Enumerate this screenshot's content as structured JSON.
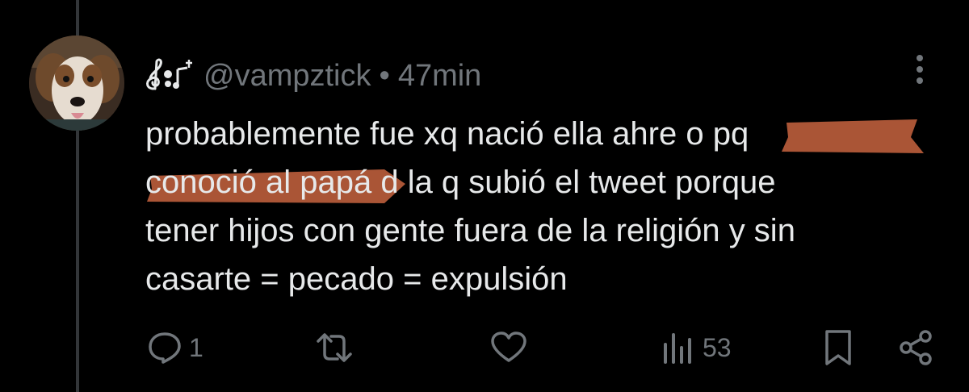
{
  "tweet": {
    "handle": "@vampztick",
    "separator": "•",
    "timestamp": "47min",
    "text_lines": [
      "probablemente fue xq nació ella ahre o pq",
      "conoció al papá d la q subió el tweet porque",
      "tener hijos con gente fuera de la religión y sin",
      "casarte = pecado = expulsión"
    ],
    "highlighted_phrases": [
      "o pq",
      "conoció al pap"
    ],
    "highlight_color": "#c8643f"
  },
  "actions": {
    "reply_count": "1",
    "retweet_count": "",
    "like_count": "",
    "view_count": "53"
  },
  "icons": {
    "display_name": "music-notes-icon",
    "more": "more-options-icon",
    "reply": "reply-icon",
    "retweet": "retweet-icon",
    "like": "heart-icon",
    "views": "views-icon",
    "bookmark": "bookmark-icon",
    "share": "share-icon"
  },
  "colors": {
    "background": "#000000",
    "text": "#e7e9ea",
    "secondary": "#71767b",
    "thread_line": "#333639"
  }
}
